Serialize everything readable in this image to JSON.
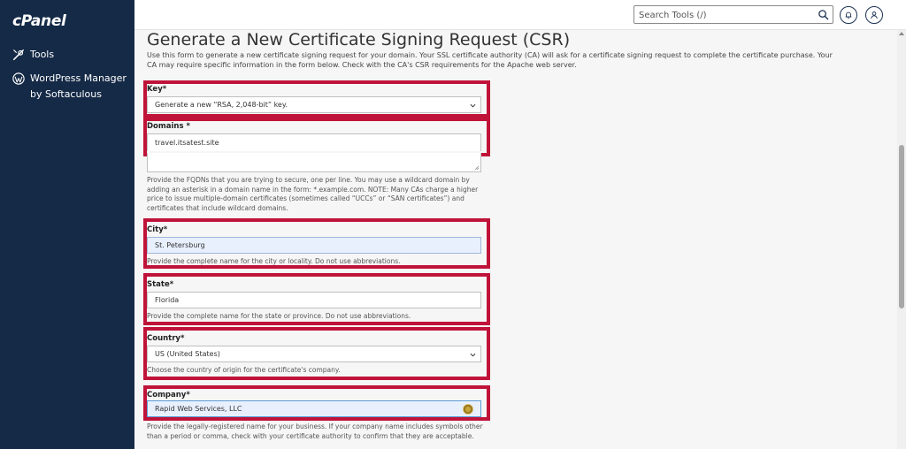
{
  "app": {
    "logo_text": "cPanel"
  },
  "sidebar": {
    "items": [
      {
        "label": "Tools",
        "icon": "tools-icon"
      },
      {
        "label": "WordPress Manager by Softaculous",
        "icon": "wordpress-icon"
      }
    ]
  },
  "header": {
    "search_placeholder": "Search Tools (/)",
    "icons": [
      "search-icon",
      "bell-icon",
      "user-icon"
    ]
  },
  "page": {
    "title": "Generate a New Certificate Signing Request (CSR)",
    "intro": "Use this form to generate a new certificate signing request for your domain. Your SSL certificate authority (CA) will ask for a certificate signing request to complete the certificate purchase. Your CA may require specific information in the form below. Check with the CA's CSR requirements for the Apache web server."
  },
  "form": {
    "key": {
      "label": "Key*",
      "value": "Generate a new “RSA, 2,048-bit” key."
    },
    "domains": {
      "label": "Domains *",
      "value": "travel.itsatest.site",
      "help": "Provide the FQDNs that you are trying to secure, one per line. You may use a wildcard domain by adding an asterisk in a domain name in the form: *.example.com. NOTE: Many CAs charge a higher price to issue multiple-domain certificates (sometimes called “UCCs” or “SAN certificates”) and certificates that include wildcard domains."
    },
    "city": {
      "label": "City*",
      "value": "St. Petersburg",
      "help": "Provide the complete name for the city or locality. Do not use abbreviations."
    },
    "state": {
      "label": "State*",
      "value": "Florida",
      "help": "Provide the complete name for the state or province. Do not use abbreviations."
    },
    "country": {
      "label": "Country*",
      "value": "US (United States)",
      "help": "Choose the country of origin for the certificate's company."
    },
    "company": {
      "label": "Company*",
      "value": "Rapid Web Services, LLC",
      "help": "Provide the legally-registered name for your business. If your company name includes symbols other than a period or comma, check with your certificate authority to confirm that they are acceptable."
    }
  },
  "colors": {
    "sidebar_bg": "#152a47",
    "highlight": "#c01339",
    "autofill_bg": "#e8f0fe"
  }
}
